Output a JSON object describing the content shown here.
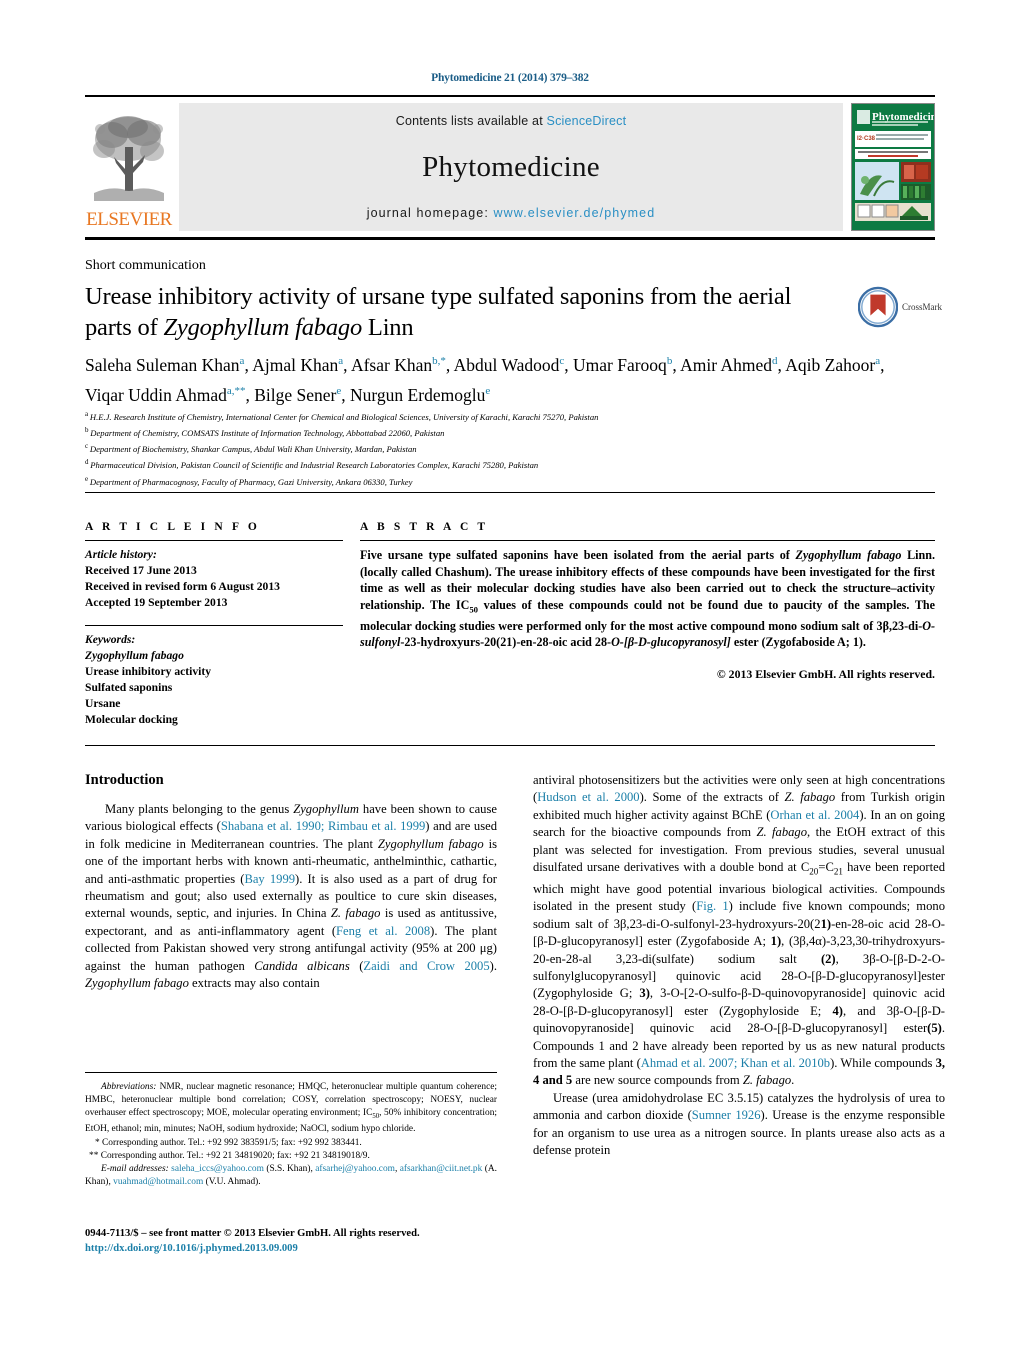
{
  "header": {
    "citation": "Phytomedicine 21 (2014) 379–382",
    "contents_prefix": "Contents lists available at ",
    "contents_link": "ScienceDirect",
    "journal_name": "Phytomedicine",
    "homepage_prefix": "journal homepage: ",
    "homepage_url": "www.elsevier.de/phymed",
    "publisher_logo_text": "ELSEVIER",
    "cover_title": "Phytomedicine",
    "link_color": "#2a8fc4"
  },
  "article": {
    "type": "Short communication",
    "title_line1": "Urease inhibitory activity of ursane type sulfated saponins from the",
    "title_line2_pre": "aerial parts of ",
    "title_line2_italic": "Zygophyllum fabago",
    "title_line2_post": " Linn",
    "crossmark_label": "CrossMark"
  },
  "authors": {
    "list": [
      {
        "name": "Saleha Suleman Khan",
        "marks": "a"
      },
      {
        "name": "Ajmal Khan",
        "marks": "a"
      },
      {
        "name": "Afsar Khan",
        "marks": "b,*"
      },
      {
        "name": "Abdul Wadood",
        "marks": "c"
      },
      {
        "name": "Umar Farooq",
        "marks": "b"
      },
      {
        "name": "Amir Ahmed",
        "marks": "d"
      },
      {
        "name": "Aqib Zahoor",
        "marks": "a"
      },
      {
        "name": "Viqar Uddin Ahmad",
        "marks": "a,**"
      },
      {
        "name": "Bilge Sener",
        "marks": "e"
      },
      {
        "name": "Nurgun Erdemoglu",
        "marks": "e"
      }
    ],
    "affiliations": [
      {
        "mark": "a",
        "text": "H.E.J. Research Institute of Chemistry, International Center for Chemical and Biological Sciences, University of Karachi, Karachi 75270, Pakistan"
      },
      {
        "mark": "b",
        "text": "Department of Chemistry, COMSATS Institute of Information Technology, Abbottabad 22060, Pakistan"
      },
      {
        "mark": "c",
        "text": "Department of Biochemistry, Shankar Campus, Abdul Wali Khan University, Mardan, Pakistan"
      },
      {
        "mark": "d",
        "text": "Pharmaceutical Division, Pakistan Council of Scientific and Industrial Research Laboratories Complex, Karachi 75280, Pakistan"
      },
      {
        "mark": "e",
        "text": "Department of Pharmacognosy, Faculty of Pharmacy, Gazi University, Ankara 06330, Turkey"
      }
    ]
  },
  "article_info": {
    "heading": "A R T I C L E   I N F O",
    "history_label": "Article history:",
    "history": [
      "Received 17 June 2013",
      "Received in revised form 6 August 2013",
      "Accepted 19 September 2013"
    ],
    "keywords_label": "Keywords:",
    "keywords": [
      "Zygophyllum fabago",
      "Urease inhibitory activity",
      "Sulfated saponins",
      "Ursane",
      "Molecular docking"
    ]
  },
  "abstract": {
    "heading": "A B S T R A C T",
    "text": "Five ursane type sulfated saponins have been isolated from the aerial parts of Zygophyllum fabago Linn. (locally called Chashum). The urease inhibitory effects of these compounds have been investigated for the first time as well as their molecular docking studies have also been carried out to check the structure–activity relationship. The IC50 values of these compounds could not be found due to paucity of the samples. The molecular docking studies were performed only for the most active compound mono sodium salt of 3β,23-di-O-sulfonyl-23-hydroxyurs-20(21)-en-28-oic acid 28-O-[β-D-glucopyranosyl] ester (Zygofaboside A; 1).",
    "copyright": "© 2013 Elsevier GmbH. All rights reserved."
  },
  "body": {
    "intro_heading": "Introduction",
    "left_paragraph_1": "Many plants belonging to the genus Zygophyllum have been shown to cause various biological effects (Shabana et al. 1990; Rimbau et al. 1999) and are used in folk medicine in Mediterranean countries. The plant Zygophyllum fabago is one of the important herbs with known anti-rheumatic, anthelminthic, cathartic, and anti-asthmatic properties (Bay 1999). It is also used as a part of drug for rheumatism and gout; also used externally as poultice to cure skin diseases, external wounds, septic, and injuries. In China Z. fabago is used as antitussive, expectorant, and as anti-inflammatory agent (Feng et al. 2008). The plant collected from Pakistan showed very strong antifungal activity (95% at 200 μg) against the human pathogen Candida albicans (Zaidi and Crow 2005). Zygophyllum fabago extracts may also contain",
    "right_paragraph_1": "antiviral photosensitizers but the activities were only seen at high concentrations (Hudson et al. 2000). Some of the extracts of Z. fabago from Turkish origin exhibited much higher activity against BChE (Orhan et al. 2004). In an on going search for the bioactive compounds from Z. fabago, the EtOH extract of this plant was selected for investigation. From previous studies, several unusual disulfated ursane derivatives with a double bond at C20=C21 have been reported which might have good potential invarious biological activities. Compounds isolated in the present study (Fig. 1) include five known compounds; mono sodium salt of 3β,23-di-O-sulfonyl-23-hydroxyurs-20(21)-en-28-oic acid 28-O-[β-D-glucopyranosyl] ester (Zygofaboside A; 1), (3β,4α)-3,23,30-trihydroxyurs-20-en-28-al 3,23-di(sulfate) sodium salt (2), 3β-O-[β-D-2-O-sulfonylglucopyranosyl] quinovic acid 28-O-[β-D-glucopyranosyl]ester (Zygophyloside G; 3), 3-O-[2-O-sulfo-β-D-quinovopyranoside] quinovic acid 28-O-[β-D-glucopyranosyl] ester (Zygophyloside E; 4), and 3β-O-[β-D-quinovopyranoside] quinovic acid 28-O-[β-D-glucopyranosyl] ester(5). Compounds 1 and 2 have already been reported by us as new natural products from the same plant (Ahmad et al. 2007; Khan et al. 2010b). While compounds 3, 4 and 5 are new source compounds from Z. fabago.",
    "right_paragraph_2": "Urease (urea amidohydrolase EC 3.5.15) catalyzes the hydrolysis of urea to ammonia and carbon dioxide (Sumner 1926). Urease is the enzyme responsible for an organism to use urea as a nitrogen source. In plants urease also acts as a defense protein"
  },
  "footnotes": {
    "abbreviations_label": "Abbreviations:",
    "abbreviations_text": "NMR, nuclear magnetic resonance; HMQC, heteronuclear multiple quantum coherence; HMBC, heteronuclear multiple bond correlation; COSY, correlation spectroscopy; NOESY, nuclear overhauser effect spectroscopy; MOE, molecular operating environment; IC50, 50% inhibitory concentration; EtOH, ethanol; min, minutes; NaOH, sodium hydroxide; NaOCl, sodium hypo chloride.",
    "corresponding_1": "* Corresponding author. Tel.: +92 992 383591/5; fax: +92 992 383441.",
    "corresponding_2": "** Corresponding author. Tel.: +92 21 34819020; fax: +92 21 34819018/9.",
    "email_label": "E-mail addresses:",
    "emails": [
      {
        "address": "saleha_iccs@yahoo.com",
        "owner": "(S.S. Khan)"
      },
      {
        "address": "afsarhej@yahoo.com",
        "owner": ""
      },
      {
        "address": "afsarkhan@ciit.net.pk",
        "owner": "(A. Khan)"
      },
      {
        "address": "vuahmad@hotmail.com",
        "owner": "(V.U. Ahmad)"
      }
    ]
  },
  "footer": {
    "front_matter": "0944-7113/$ – see front matter © 2013 Elsevier GmbH. All rights reserved.",
    "doi": "http://dx.doi.org/10.1016/j.phymed.2013.09.009"
  }
}
